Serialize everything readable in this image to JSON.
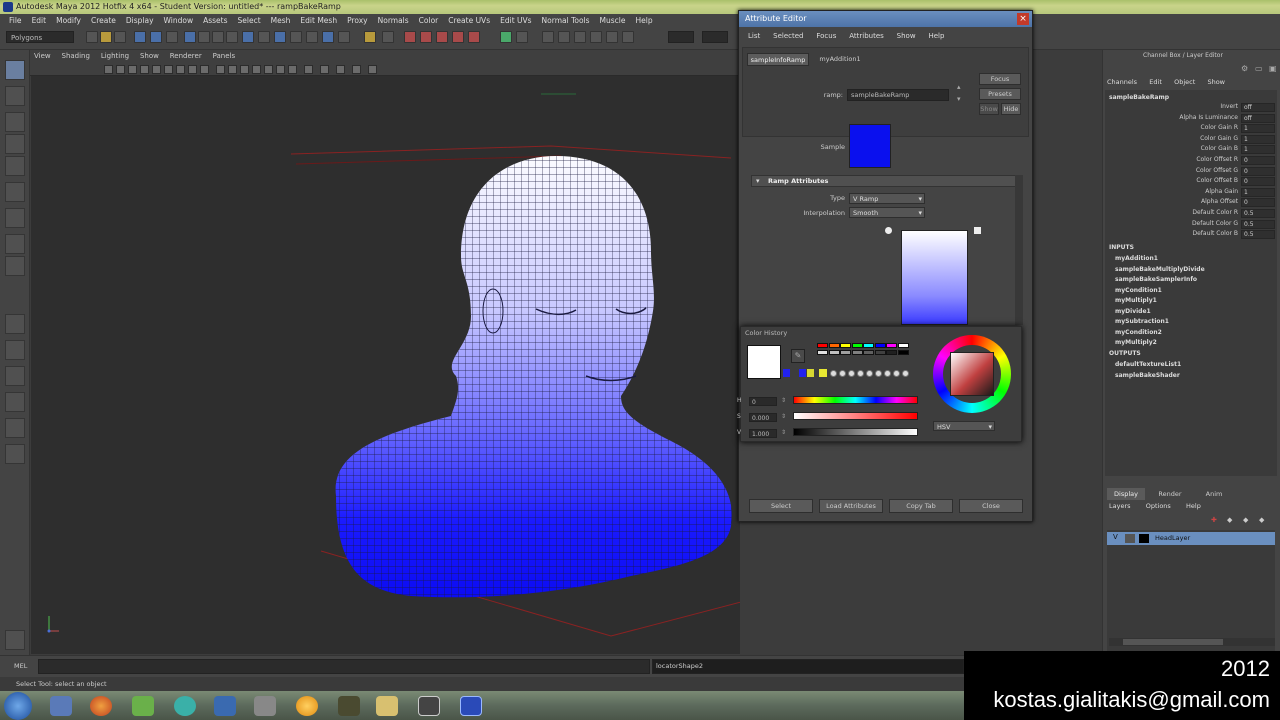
{
  "window": {
    "title": "Autodesk Maya 2012 Hotfix 4 x64 - Student Version: untitled*   ---   rampBakeRamp"
  },
  "menubar": [
    "File",
    "Edit",
    "Modify",
    "Create",
    "Display",
    "Window",
    "Assets",
    "Select",
    "Mesh",
    "Edit Mesh",
    "Proxy",
    "Normals",
    "Color",
    "Create UVs",
    "Edit UVs",
    "Normal Tools",
    "Muscle",
    "Help"
  ],
  "shelf": {
    "mode_menu": "Polygons"
  },
  "viewport": {
    "menu": [
      "View",
      "Shading",
      "Lighting",
      "Show",
      "Renderer",
      "Panels"
    ]
  },
  "attribute_editor": {
    "title": "Attribute Editor",
    "close_glyph": "×",
    "menu": [
      "List",
      "Selected",
      "Focus",
      "Attributes",
      "Show",
      "Help"
    ],
    "tabs": [
      "sampleInfoRamp",
      "myAddition1"
    ],
    "ramp_label": "ramp:",
    "ramp_value": "sampleBakeRamp",
    "focus_btn": "Focus",
    "presets_btn": "Presets",
    "show_btn": "Show",
    "hide_btn": "Hide",
    "sample_label": "Sample",
    "sample_color": "#0a10ee",
    "section": "Ramp Attributes",
    "type_label": "Type",
    "type_value": "V Ramp",
    "interp_label": "Interpolation",
    "interp_value": "Smooth",
    "bottom_buttons": [
      "Select",
      "Load Attributes",
      "Copy Tab",
      "Close"
    ]
  },
  "color_picker": {
    "title": "Color History",
    "current_color": "#ffffff",
    "h_label": "H",
    "h_value": "0",
    "s_label": "S",
    "s_value": "0.000",
    "v_label": "V",
    "v_value": "1.000",
    "mode": "HSV",
    "swatches": [
      "#ff0000",
      "#ff6600",
      "#ffff00",
      "#00ff00",
      "#00ffff",
      "#0000ff",
      "#ff00ff",
      "#ffffff",
      "#e0e0e0",
      "#c0c0c0",
      "#a0a0a0",
      "#808080",
      "#606060",
      "#404040",
      "#202020",
      "#000000"
    ]
  },
  "channel_box": {
    "header": "Channel Box / Layer Editor",
    "menu": [
      "Channels",
      "Edit",
      "Object",
      "Show"
    ],
    "node": "sampleBakeRamp",
    "attrs": [
      {
        "name": "Invert",
        "value": "off"
      },
      {
        "name": "Alpha Is Luminance",
        "value": "off"
      },
      {
        "name": "Color Gain R",
        "value": "1"
      },
      {
        "name": "Color Gain G",
        "value": "1"
      },
      {
        "name": "Color Gain B",
        "value": "1"
      },
      {
        "name": "Color Offset R",
        "value": "0"
      },
      {
        "name": "Color Offset G",
        "value": "0"
      },
      {
        "name": "Color Offset B",
        "value": "0"
      },
      {
        "name": "Alpha Gain",
        "value": "1"
      },
      {
        "name": "Alpha Offset",
        "value": "0"
      },
      {
        "name": "Default Color R",
        "value": "0.5"
      },
      {
        "name": "Default Color G",
        "value": "0.5"
      },
      {
        "name": "Default Color B",
        "value": "0.5"
      }
    ],
    "inputs_label": "INPUTS",
    "inputs": [
      "myAddition1",
      "sampleBakeMultiplyDivide",
      "sampleBakeSamplerInfo",
      "myCondition1",
      "myMultiply1",
      "myDivide1",
      "mySubtraction1",
      "myCondition2",
      "myMultiply2"
    ],
    "outputs_label": "OUTPUTS",
    "outputs": [
      "defaultTextureList1",
      "sampleBakeShader"
    ],
    "layer_tabs": [
      "Display",
      "Render",
      "Anim"
    ],
    "layer_menu": [
      "Layers",
      "Options",
      "Help"
    ],
    "layer_name": "HeadLayer"
  },
  "command_line": {
    "lang": "MEL",
    "result": "locatorShape2"
  },
  "help_line": "Select Tool: select an object",
  "watermark": {
    "year": "2012",
    "email": "kostas.gialitakis@gmail.com"
  }
}
